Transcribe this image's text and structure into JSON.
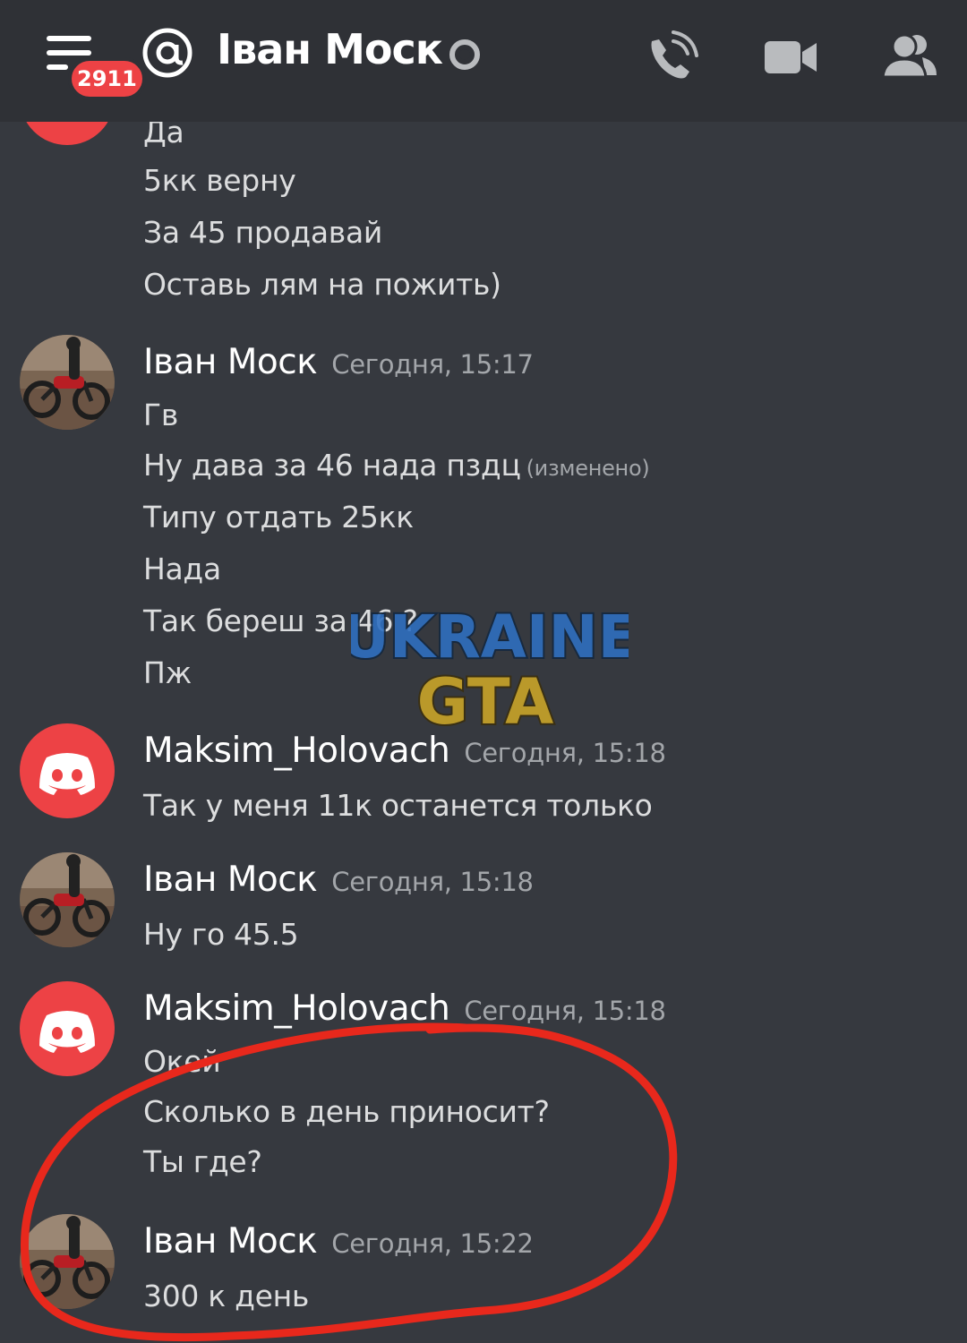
{
  "header": {
    "badge_count": "2911",
    "title": "Іван Моск",
    "icons": [
      "hamburger-menu-icon",
      "at-mention-icon",
      "status-ring-icon",
      "voice-call-icon",
      "video-call-icon",
      "members-icon"
    ]
  },
  "messages": [
    {
      "lines": [
        "Да",
        "5кк верну",
        "За 45 продавай",
        "Оставь лям на пожить)"
      ]
    },
    {
      "author": "Іван Моск",
      "timestamp": "Сегодня, 15:17",
      "lines": [
        "Гв",
        "Ну дава за 46 нада пздц",
        "Типу отдать 25кк",
        "Нада",
        "Так береш за 46 ?",
        "Пж"
      ],
      "edited_label": "(изменено)"
    },
    {
      "author": "Maksim_Holovach",
      "timestamp": "Сегодня, 15:18",
      "lines": [
        "Так у меня 11к останется только"
      ]
    },
    {
      "author": "Іван Моск",
      "timestamp": "Сегодня, 15:18",
      "lines": [
        "Ну го 45.5"
      ]
    },
    {
      "author": "Maksim_Holovach",
      "timestamp": "Сегодня, 15:18",
      "lines": [
        "Окей",
        "Сколько в день приносит?",
        "Ты где?"
      ]
    },
    {
      "author": "Іван Моск",
      "timestamp": "Сегодня, 15:22",
      "lines": [
        "300 к день"
      ]
    }
  ],
  "watermark": {
    "line1": "UKRAINE",
    "line2": "GTA"
  },
  "colors": {
    "background": "#36393f",
    "header": "#2f3136",
    "discord_red": "#ed4245",
    "annotation_red": "#e8281c"
  }
}
